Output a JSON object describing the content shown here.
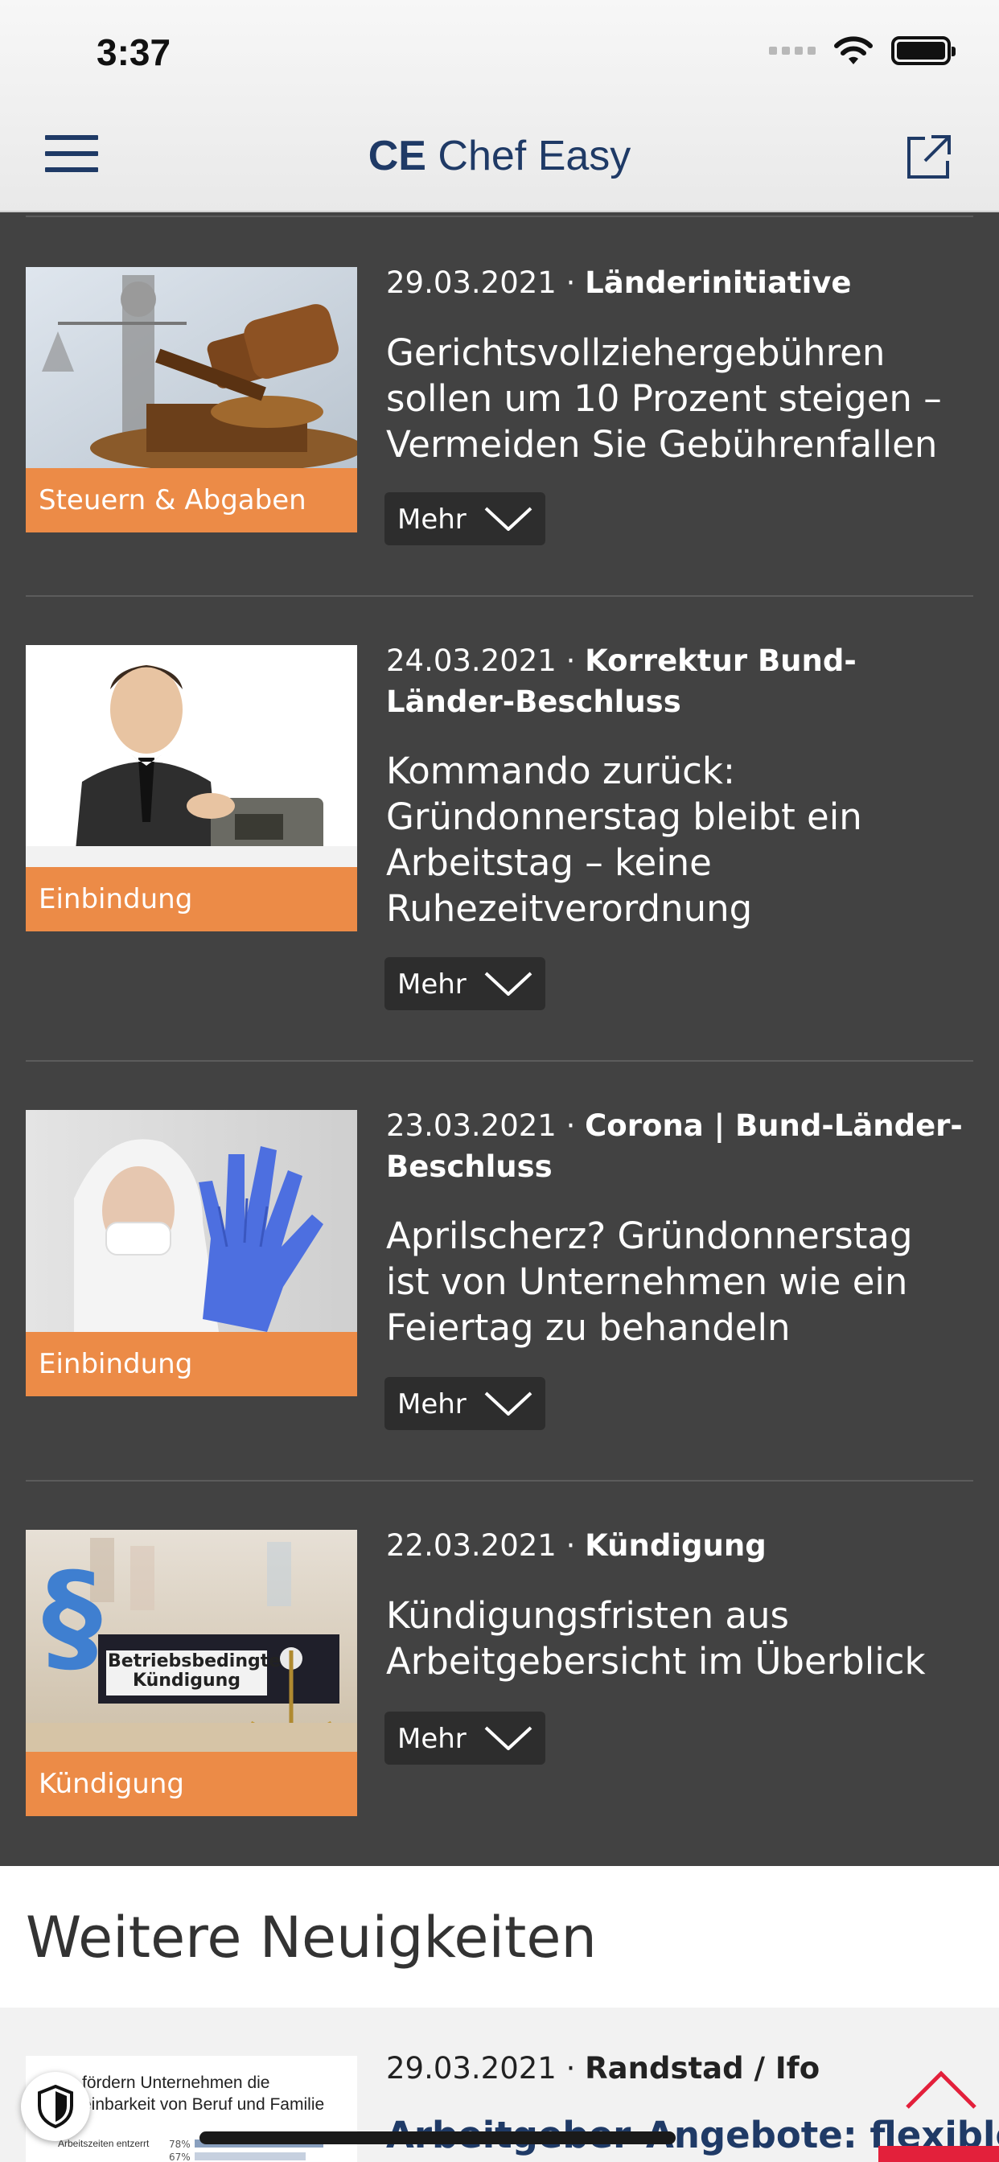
{
  "status_bar": {
    "time": "3:37"
  },
  "nav": {
    "logo_bold": "CE",
    "logo_rest": " Chef Easy"
  },
  "articles": [
    {
      "date": "29.03.2021",
      "separator": " · ",
      "category": "Länderinitiative",
      "title": "Gerichtsvollziehergebühren sollen um 10 Prozent steigen – Vermeiden Sie Gebührenfallen",
      "tag": "Steuern & Abgaben",
      "more": "Mehr"
    },
    {
      "date": "24.03.2021",
      "separator": " · ",
      "category": "Korrektur Bund-Länder-Beschluss",
      "title": "Kommando zurück: Gründonnerstag bleibt ein Arbeitstag – keine Ruhezeitverordnung",
      "tag": "Einbindung",
      "more": "Mehr"
    },
    {
      "date": "23.03.2021",
      "separator": " · ",
      "category": "Corona | Bund-Länder-Beschluss",
      "title": "Aprilscherz? Gründonnerstag ist von Unternehmen wie ein Feiertag zu behandeln",
      "tag": "Einbindung",
      "more": "Mehr"
    },
    {
      "date": "22.03.2021",
      "separator": " · ",
      "category": "Kündigung",
      "title": "Kündigungsfristen aus Arbeitgebersicht im Überblick",
      "tag": "Kündigung",
      "more": "Mehr",
      "image_label": "Betriebsbedingte Kündigung"
    }
  ],
  "section": {
    "title": "Weitere Neuigkeiten"
  },
  "next_article": {
    "date": "29.03.2021",
    "separator": " · ",
    "category": "Randstad / Ifo",
    "title": "Arbeitgeber-Angebote: flexibles",
    "thumb_text": "fördern Unternehmen die\neinbarkeit von Beruf und Familie",
    "thumb_small": "Arbeitszeiten entzerrt",
    "thumb_pct1": "78%",
    "thumb_pct2": "67%"
  },
  "colors": {
    "accent_orange": "#ec8b47",
    "dark_bg": "#424242",
    "brand_blue": "#1f3a66",
    "red": "#e3203b"
  }
}
